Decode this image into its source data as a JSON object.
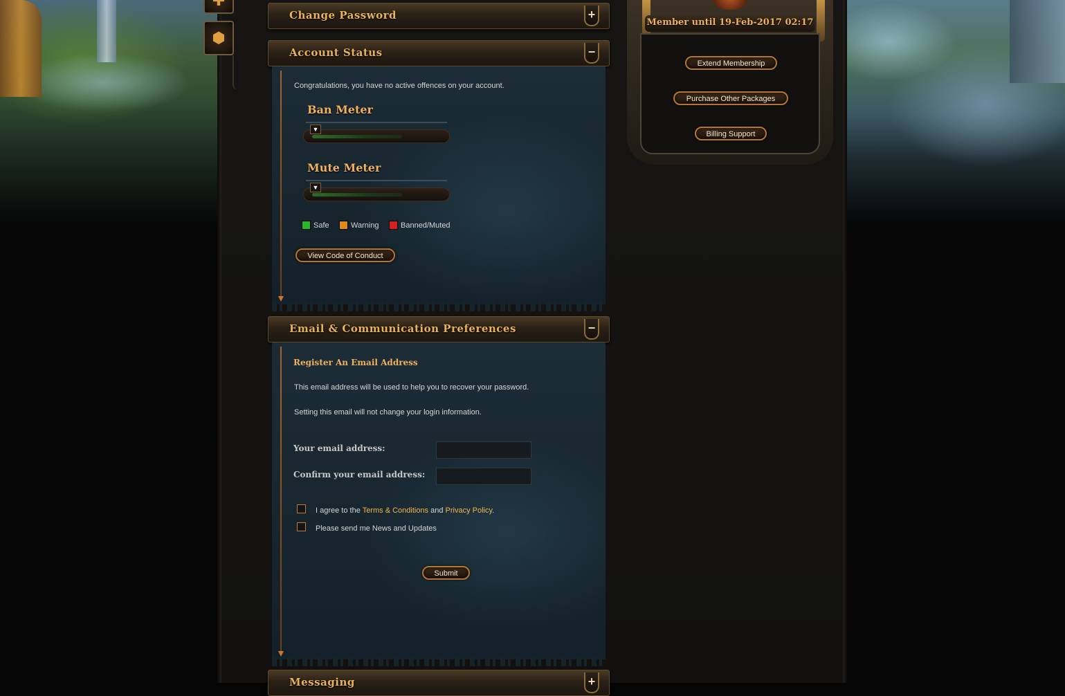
{
  "sections": {
    "change_password": {
      "title": "Change Password",
      "toggle": "+"
    },
    "account_status": {
      "title": "Account Status",
      "toggle": "−"
    },
    "email_prefs": {
      "title": "Email & Communication Preferences",
      "toggle": "−"
    },
    "messaging": {
      "title": "Messaging",
      "toggle": "+"
    }
  },
  "account_status": {
    "message": "Congratulations, you have no active offences on your account.",
    "ban_meter": {
      "title": "Ban Meter",
      "level": 0
    },
    "mute_meter": {
      "title": "Mute Meter",
      "level": 0
    },
    "legend": {
      "safe": "Safe",
      "warning": "Warning",
      "banned": "Banned/Muted"
    },
    "code_button": "View Code of Conduct"
  },
  "email": {
    "heading": "Register An Email Address",
    "info1": "This email address will be used to help you to recover your password.",
    "info2": "Setting this email will not change your login information.",
    "email_label": "Your email address:",
    "confirm_label": "Confirm your email address:",
    "email_value": "",
    "confirm_value": "",
    "agree_prefix": "I agree to the ",
    "terms_link": "Terms & Conditions",
    "agree_and": " and ",
    "privacy_link": "Privacy Policy",
    "agree_suffix": ".",
    "news_label": "Please send me News and Updates",
    "agree_checked": false,
    "news_checked": false,
    "submit": "Submit"
  },
  "membership": {
    "title": "Member until 19-Feb-2017 02:17",
    "extend": "Extend Membership",
    "packages": "Purchase Other Packages",
    "billing": "Billing Support"
  },
  "colors": {
    "safe": "#2bb52b",
    "warning": "#e08a1c",
    "banned": "#d62020",
    "gold_text": "#eeb15e",
    "panel": "#1c2c36"
  }
}
